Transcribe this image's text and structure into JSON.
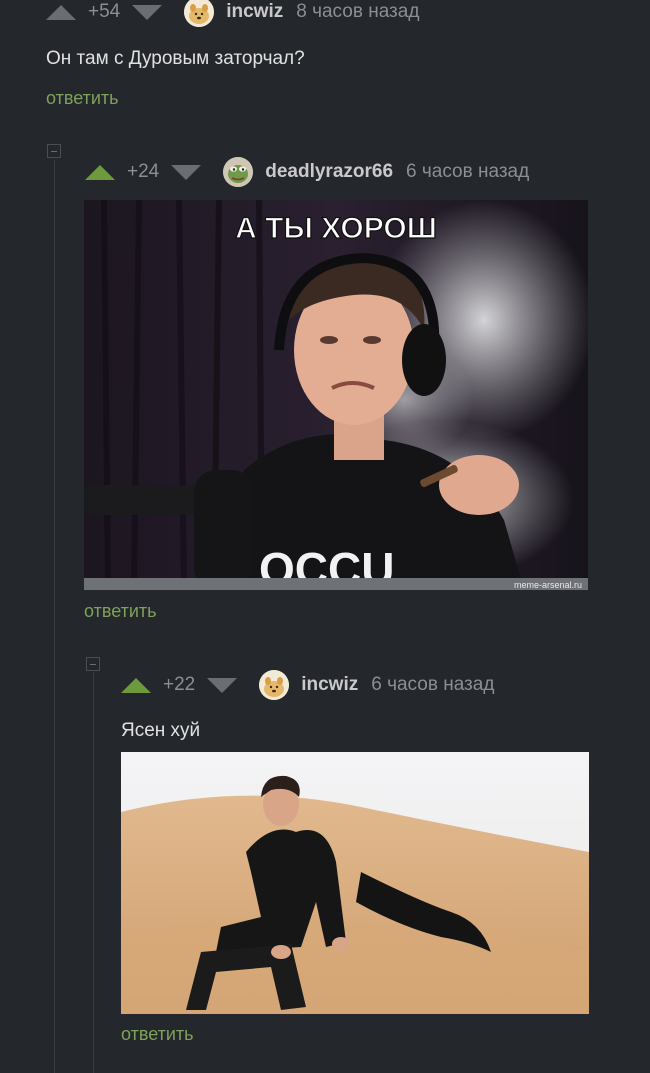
{
  "colors": {
    "background": "#24272b",
    "upvote_active": "#6c9a3c",
    "downvote": "#6a6d72",
    "reply_link": "#7ea25a",
    "thread_line": "#3a3d42"
  },
  "comments": [
    {
      "rating": "+54",
      "username": "incwiz",
      "time": "8 часов назад",
      "avatar_icon": "cheems-dog-avatar",
      "text": "Он там с Дуровым заторчал?",
      "reply_label": "ответить"
    },
    {
      "rating": "+24",
      "username": "deadlyrazor66",
      "time": "6 часов назад",
      "avatar_icon": "pepe-frog-avatar",
      "image": {
        "caption": "А ТЫ ХОРОШ",
        "watermark": "meme-arsenal.ru",
        "description": "man in headphones smoking at a podcast microphone"
      },
      "reply_label": "ответить"
    },
    {
      "rating": "+22",
      "username": "incwiz",
      "time": "6 часов назад",
      "avatar_icon": "cheems-dog-avatar",
      "text": "Ясен хуй",
      "image": {
        "description": "man in black sitting on a desert sand dune"
      },
      "reply_label": "ответить"
    }
  ]
}
